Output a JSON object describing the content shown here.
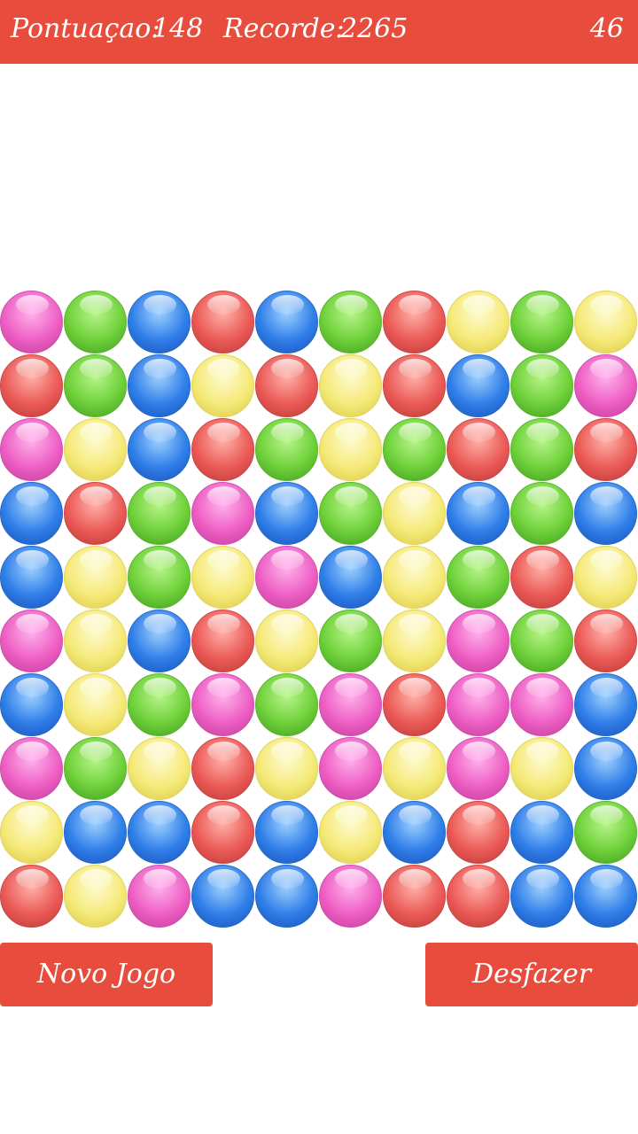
{
  "header": {
    "score_label": "Pontuaçao:",
    "score_value": "148",
    "record_label": "Recorde:",
    "record_value": "2265",
    "moves_left": "46"
  },
  "colors": {
    "header_bg": "#e74c3c",
    "button_bg": "#e74c3c",
    "pink": "#ee5fc4",
    "green": "#6fd13a",
    "blue": "#2f7fe8",
    "red": "#eb5a57",
    "yellow": "#f5ea78"
  },
  "board": {
    "rows": [
      [
        "pink",
        "green",
        "blue",
        "red",
        "blue",
        "green",
        "red",
        "yellow",
        "green",
        "yellow"
      ],
      [
        "red",
        "green",
        "blue",
        "yellow",
        "red",
        "yellow",
        "red",
        "blue",
        "green",
        "pink"
      ],
      [
        "pink",
        "yellow",
        "blue",
        "red",
        "green",
        "yellow",
        "green",
        "red",
        "green",
        "red"
      ],
      [
        "blue",
        "red",
        "green",
        "pink",
        "blue",
        "green",
        "yellow",
        "blue",
        "green",
        "blue"
      ],
      [
        "blue",
        "yellow",
        "green",
        "yellow",
        "pink",
        "blue",
        "yellow",
        "green",
        "red",
        "yellow"
      ],
      [
        "pink",
        "yellow",
        "blue",
        "red",
        "yellow",
        "green",
        "yellow",
        "pink",
        "green",
        "red"
      ],
      [
        "blue",
        "yellow",
        "green",
        "pink",
        "green",
        "pink",
        "red",
        "pink",
        "pink",
        "blue"
      ],
      [
        "pink",
        "green",
        "yellow",
        "red",
        "yellow",
        "pink",
        "yellow",
        "pink",
        "yellow",
        "blue"
      ],
      [
        "yellow",
        "blue",
        "blue",
        "red",
        "blue",
        "yellow",
        "blue",
        "red",
        "blue",
        "green"
      ],
      [
        "red",
        "yellow",
        "pink",
        "blue",
        "blue",
        "pink",
        "red",
        "red",
        "blue",
        "blue"
      ]
    ]
  },
  "buttons": {
    "new_game": "Novo Jogo",
    "undo": "Desfazer"
  }
}
